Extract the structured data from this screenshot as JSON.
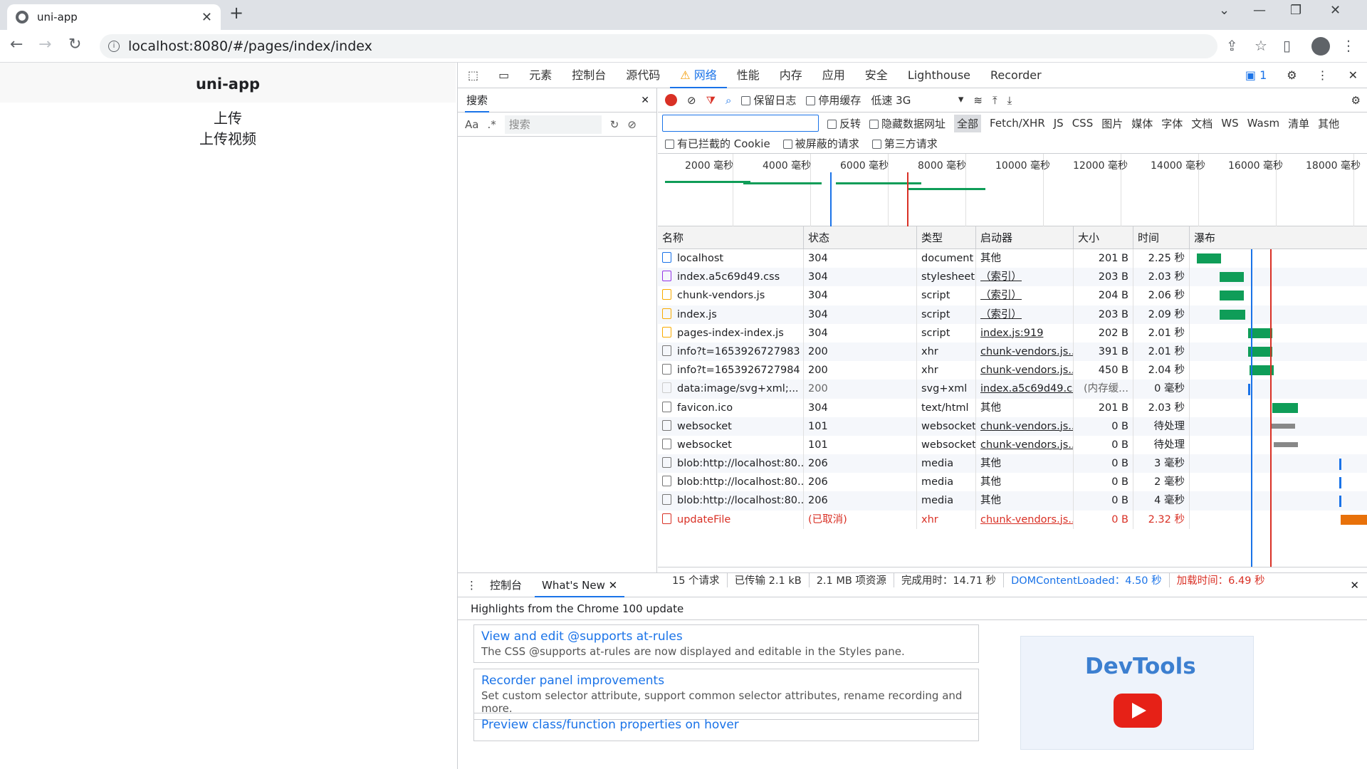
{
  "browser": {
    "tab_title": "uni-app",
    "url": "localhost:8080/#/pages/index/index"
  },
  "page": {
    "header": "uni-app",
    "lines": [
      "上传",
      "上传视频"
    ]
  },
  "devtools": {
    "tabs": [
      "元素",
      "控制台",
      "源代码",
      "网络",
      "性能",
      "内存",
      "应用",
      "安全",
      "Lighthouse",
      "Recorder"
    ],
    "badge": "1",
    "search": {
      "title": "搜索",
      "case_label": "Aa",
      "regex_label": ".*",
      "placeholder": "搜索"
    },
    "toolbar": {
      "preserve_log": "保留日志",
      "disable_cache": "停用缓存",
      "throttle": "低速 3G"
    },
    "filters": {
      "invert": "反转",
      "hide_data_urls": "隐藏数据网址",
      "types": [
        "全部",
        "Fetch/XHR",
        "JS",
        "CSS",
        "图片",
        "媒体",
        "字体",
        "文档",
        "WS",
        "Wasm",
        "清单",
        "其他"
      ],
      "blocked_cookies": "有已拦截的 Cookie",
      "blocked_requests": "被屏蔽的请求",
      "third_party": "第三方请求"
    },
    "overview_ticks": [
      "2000 毫秒",
      "4000 毫秒",
      "6000 毫秒",
      "8000 毫秒",
      "10000 毫秒",
      "12000 毫秒",
      "14000 毫秒",
      "16000 毫秒",
      "18000 毫秒"
    ],
    "columns": [
      "名称",
      "状态",
      "类型",
      "启动器",
      "大小",
      "时间",
      "瀑布"
    ],
    "rows": [
      {
        "name": "localhost",
        "status": "304",
        "type": "document",
        "initiator": "其他",
        "size": "201 B",
        "time": "2.25 秒",
        "icon": "doc"
      },
      {
        "name": "index.a5c69d49.css",
        "status": "304",
        "type": "stylesheet",
        "initiator": "（索引）",
        "size": "203 B",
        "time": "2.03 秒",
        "icon": "css"
      },
      {
        "name": "chunk-vendors.js",
        "status": "304",
        "type": "script",
        "initiator": "（索引）",
        "size": "204 B",
        "time": "2.06 秒",
        "icon": "js"
      },
      {
        "name": "index.js",
        "status": "304",
        "type": "script",
        "initiator": "（索引）",
        "size": "203 B",
        "time": "2.09 秒",
        "icon": "js"
      },
      {
        "name": "pages-index-index.js",
        "status": "304",
        "type": "script",
        "initiator": "index.js:919",
        "size": "202 B",
        "time": "2.01 秒",
        "icon": "js"
      },
      {
        "name": "info?t=1653926727983",
        "status": "200",
        "type": "xhr",
        "initiator": "chunk-vendors.js...",
        "size": "391 B",
        "time": "2.01 秒",
        "icon": "file"
      },
      {
        "name": "info?t=1653926727984",
        "status": "200",
        "type": "xhr",
        "initiator": "chunk-vendors.js...",
        "size": "450 B",
        "time": "2.04 秒",
        "icon": "file"
      },
      {
        "name": "data:image/svg+xml;...",
        "status": "200",
        "type": "svg+xml",
        "initiator": "index.a5c69d49.css",
        "size": "(内存缓...",
        "time": "0 毫秒",
        "icon": "img"
      },
      {
        "name": "favicon.ico",
        "status": "304",
        "type": "text/html",
        "initiator": "其他",
        "size": "201 B",
        "time": "2.03 秒",
        "icon": "file"
      },
      {
        "name": "websocket",
        "status": "101",
        "type": "websocket",
        "initiator": "chunk-vendors.js...",
        "size": "0 B",
        "time": "待处理",
        "icon": "file"
      },
      {
        "name": "websocket",
        "status": "101",
        "type": "websocket",
        "initiator": "chunk-vendors.js...",
        "size": "0 B",
        "time": "待处理",
        "icon": "file"
      },
      {
        "name": "blob:http://localhost:80...",
        "status": "206",
        "type": "media",
        "initiator": "其他",
        "size": "0 B",
        "time": "3 毫秒",
        "icon": "file"
      },
      {
        "name": "blob:http://localhost:80...",
        "status": "206",
        "type": "media",
        "initiator": "其他",
        "size": "0 B",
        "time": "2 毫秒",
        "icon": "file"
      },
      {
        "name": "blob:http://localhost:80...",
        "status": "206",
        "type": "media",
        "initiator": "其他",
        "size": "0 B",
        "time": "4 毫秒",
        "icon": "file"
      },
      {
        "name": "updateFile",
        "status": "(已取消)",
        "type": "xhr",
        "initiator": "chunk-vendors.js...",
        "size": "0 B",
        "time": "2.32 秒",
        "icon": "err"
      }
    ],
    "statusbar": {
      "requests": "15 个请求",
      "transferred": "已传输 2.1 kB",
      "resources": "2.1 MB 项资源",
      "finish": "完成用时：14.71 秒",
      "dcl_label": "DOMContentLoaded：",
      "dcl_value": "4.50 秒",
      "load": "加载时间：6.49 秒"
    },
    "drawer": {
      "tabs": [
        "控制台",
        "What's New"
      ],
      "heading": "Highlights from the Chrome 100 update",
      "cards": [
        {
          "title": "View and edit @supports at-rules",
          "desc": "The CSS @supports at-rules are now displayed and editable in the Styles pane."
        },
        {
          "title": "Recorder panel improvements",
          "desc": "Set custom selector attribute, support common selector attributes, rename recording and more."
        },
        {
          "title": "Preview class/function properties on hover",
          "desc": ""
        }
      ],
      "thumb_text": "DevTools"
    }
  },
  "colors": {
    "accent": "#1a73e8",
    "error": "#d93025",
    "waterfall_green": "#0f9d58",
    "waterfall_orange": "#e8710a"
  }
}
